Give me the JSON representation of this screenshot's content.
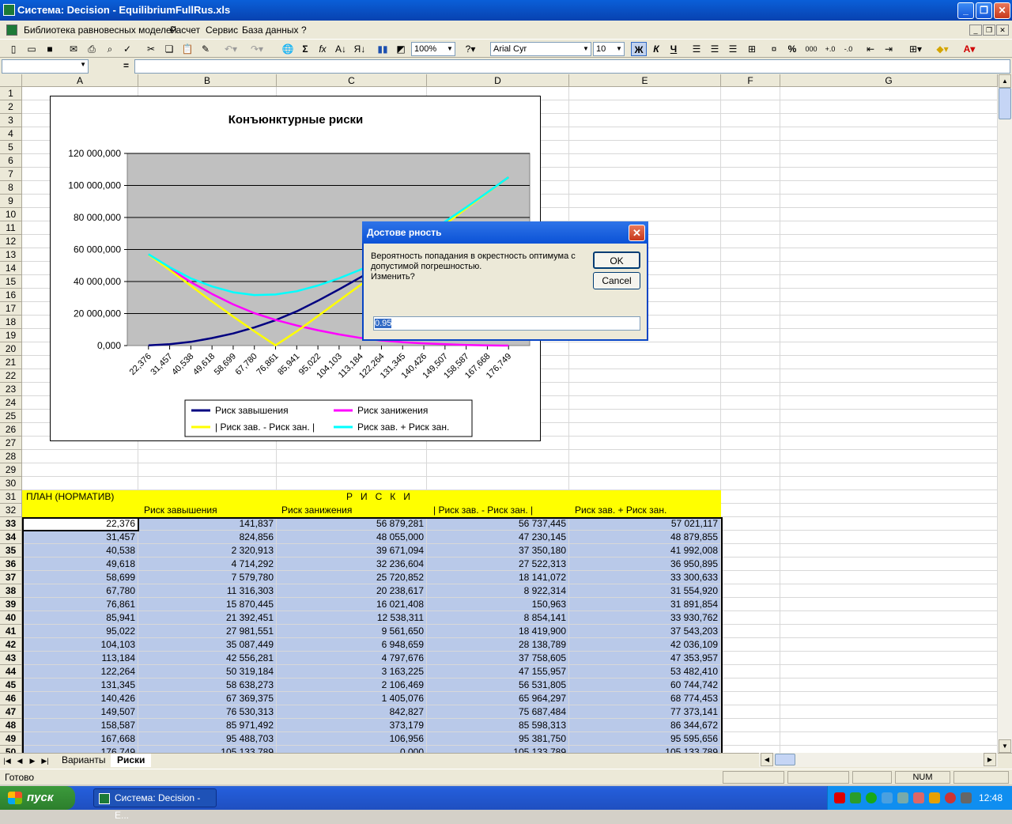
{
  "window": {
    "title": "Система: Decision - EquilibriumFullRus.xls"
  },
  "menu": [
    "Библиотека равновесных моделей",
    "Расчет",
    "Сервис",
    "База данных",
    "?"
  ],
  "toolbar": {
    "zoom": "100%",
    "font": "Arial Cyr",
    "size": "10",
    "bold": "Ж",
    "italic": "К",
    "underline": "Ч"
  },
  "formula": {
    "eq": "="
  },
  "columns": [
    "A",
    "B",
    "C",
    "D",
    "E",
    "F",
    "G"
  ],
  "rows": [
    "1",
    "2",
    "3",
    "4",
    "5",
    "6",
    "7",
    "8",
    "9",
    "10",
    "11",
    "12",
    "13",
    "14",
    "15",
    "16",
    "17",
    "18",
    "19",
    "20",
    "21",
    "22",
    "23",
    "24",
    "25",
    "26",
    "27",
    "28",
    "29",
    "30",
    "31",
    "32",
    "33",
    "34",
    "35",
    "36",
    "37",
    "38",
    "39",
    "40",
    "41",
    "42",
    "43",
    "44",
    "45",
    "46",
    "47",
    "48",
    "49",
    "50"
  ],
  "header31": {
    "plan": "ПЛАН (НОРМАТИВ)",
    "risks": "Р   И   С   К   И"
  },
  "header32": {
    "over": "Риск завышения",
    "under": "Риск занижения",
    "diff": "| Риск зав. - Риск зан. |",
    "sum": "Риск зав. + Риск зан."
  },
  "table": [
    [
      "22,376",
      "141,837",
      "56 879,281",
      "56 737,445",
      "57 021,117"
    ],
    [
      "31,457",
      "824,856",
      "48 055,000",
      "47 230,145",
      "48 879,855"
    ],
    [
      "40,538",
      "2 320,913",
      "39 671,094",
      "37 350,180",
      "41 992,008"
    ],
    [
      "49,618",
      "4 714,292",
      "32 236,604",
      "27 522,313",
      "36 950,895"
    ],
    [
      "58,699",
      "7 579,780",
      "25 720,852",
      "18 141,072",
      "33 300,633"
    ],
    [
      "67,780",
      "11 316,303",
      "20 238,617",
      "8 922,314",
      "31 554,920"
    ],
    [
      "76,861",
      "15 870,445",
      "16 021,408",
      "150,963",
      "31 891,854"
    ],
    [
      "85,941",
      "21 392,451",
      "12 538,311",
      "8 854,141",
      "33 930,762"
    ],
    [
      "95,022",
      "27 981,551",
      "9 561,650",
      "18 419,900",
      "37 543,203"
    ],
    [
      "104,103",
      "35 087,449",
      "6 948,659",
      "28 138,789",
      "42 036,109"
    ],
    [
      "113,184",
      "42 556,281",
      "4 797,676",
      "37 758,605",
      "47 353,957"
    ],
    [
      "122,264",
      "50 319,184",
      "3 163,225",
      "47 155,957",
      "53 482,410"
    ],
    [
      "131,345",
      "58 638,273",
      "2 106,469",
      "56 531,805",
      "60 744,742"
    ],
    [
      "140,426",
      "67 369,375",
      "1 405,076",
      "65 964,297",
      "68 774,453"
    ],
    [
      "149,507",
      "76 530,313",
      "842,827",
      "75 687,484",
      "77 373,141"
    ],
    [
      "158,587",
      "85 971,492",
      "373,179",
      "85 598,313",
      "86 344,672"
    ],
    [
      "167,668",
      "95 488,703",
      "106,956",
      "95 381,750",
      "95 595,656"
    ],
    [
      "176,749",
      "105 133,789",
      "0,000",
      "105 133,789",
      "105 133,789"
    ]
  ],
  "chart_data": {
    "type": "line",
    "title": "Конъюнктурные риски",
    "categories": [
      "22,376",
      "31,457",
      "40,538",
      "49,618",
      "58,699",
      "67,780",
      "76,861",
      "85,941",
      "95,022",
      "104,103",
      "113,184",
      "122,264",
      "131,345",
      "140,426",
      "149,507",
      "158,587",
      "167,668",
      "176,749"
    ],
    "ytick_labels": [
      "0,000",
      "20 000,000",
      "40 000,000",
      "60 000,000",
      "80 000,000",
      "100 000,000",
      "120 000,000"
    ],
    "ylim": [
      0,
      120000
    ],
    "legend": "bottom",
    "grid": true,
    "series": [
      {
        "name": "Риск завышения",
        "color": "#000080",
        "values": [
          141.837,
          824.856,
          2320.913,
          4714.292,
          7579.78,
          11316.303,
          15870.445,
          21392.451,
          27981.551,
          35087.449,
          42556.281,
          50319.184,
          58638.273,
          67369.375,
          76530.313,
          85971.492,
          95488.703,
          105133.789
        ]
      },
      {
        "name": "Риск занижения",
        "color": "#ff00ff",
        "values": [
          56879.281,
          48055,
          39671.094,
          32236.604,
          25720.852,
          20238.617,
          16021.408,
          12538.311,
          9561.65,
          6948.659,
          4797.676,
          3163.225,
          2106.469,
          1405.076,
          842.827,
          373.179,
          106.956,
          0
        ]
      },
      {
        "name": "| Риск зав. - Риск зан. |",
        "color": "#ffff00",
        "values": [
          56737.445,
          47230.145,
          37350.18,
          27522.313,
          18141.072,
          8922.314,
          150.963,
          8854.141,
          18419.9,
          28138.789,
          37758.605,
          47155.957,
          56531.805,
          65964.297,
          75687.484,
          85598.313,
          95381.75,
          105133.789
        ]
      },
      {
        "name": "Риск зав. + Риск зан.",
        "color": "#00ffff",
        "values": [
          57021.117,
          48879.855,
          41992.008,
          36950.895,
          33300.633,
          31554.92,
          31891.854,
          33930.762,
          37543.203,
          42036.109,
          47353.957,
          53482.41,
          60744.742,
          68774.453,
          77373.141,
          86344.672,
          95595.656,
          105133.789
        ]
      }
    ]
  },
  "sheets": {
    "tab1": "Варианты",
    "tab2": "Риски"
  },
  "status": {
    "ready": "Готово",
    "num": "NUM"
  },
  "dialog": {
    "title": "Достове рность",
    "message": "Вероятность попадания в окрестность оптимума с допустимой погрешностью.\nИзменить?",
    "ok": "OK",
    "cancel": "Cancel",
    "value": "0.95"
  },
  "taskbar": {
    "start": "пуск",
    "item": "Система: Decision - E...",
    "clock": "12:48"
  }
}
